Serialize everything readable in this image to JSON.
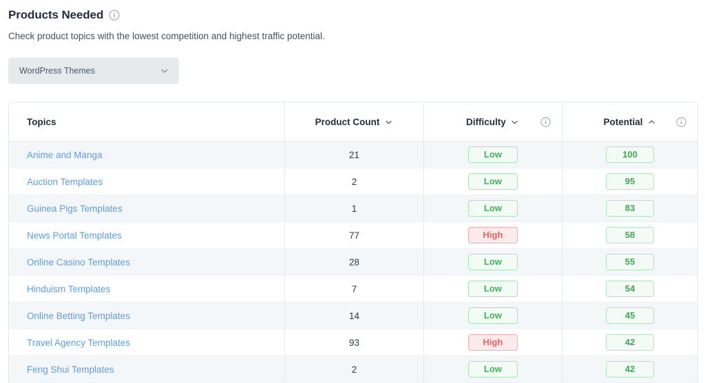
{
  "header": {
    "title": "Products Needed",
    "info_icon": "info-icon",
    "subtitle": "Check product topics with the lowest competition and highest traffic potential."
  },
  "filter": {
    "selected": "WordPress Themes",
    "chevron_icon": "chevron-down-icon"
  },
  "table": {
    "columns": [
      {
        "label": "Topics",
        "sort_icon": "",
        "info_icon": ""
      },
      {
        "label": "Product Count",
        "sort_icon": "chevron-down-icon",
        "info_icon": ""
      },
      {
        "label": "Difficulty",
        "sort_icon": "chevron-down-icon",
        "info_icon": "info-icon"
      },
      {
        "label": "Potential",
        "sort_icon": "chevron-up-icon",
        "info_icon": "info-icon"
      }
    ],
    "rows": [
      {
        "topic": "Anime and Manga",
        "product_count": "21",
        "difficulty": "Low",
        "potential": "100"
      },
      {
        "topic": "Auction Templates",
        "product_count": "2",
        "difficulty": "Low",
        "potential": "95"
      },
      {
        "topic": "Guinea Pigs Templates",
        "product_count": "1",
        "difficulty": "Low",
        "potential": "83"
      },
      {
        "topic": "News Portal Templates",
        "product_count": "77",
        "difficulty": "High",
        "potential": "58"
      },
      {
        "topic": "Online Casino Templates",
        "product_count": "28",
        "difficulty": "Low",
        "potential": "55"
      },
      {
        "topic": "Hinduism Templates",
        "product_count": "7",
        "difficulty": "Low",
        "potential": "54"
      },
      {
        "topic": "Online Betting Templates",
        "product_count": "14",
        "difficulty": "Low",
        "potential": "45"
      },
      {
        "topic": "Travel Agency Templates",
        "product_count": "93",
        "difficulty": "High",
        "potential": "42"
      },
      {
        "topic": "Feng Shui Templates",
        "product_count": "2",
        "difficulty": "Low",
        "potential": "42"
      }
    ]
  },
  "colors": {
    "link": "#5c9ee0",
    "low_text": "#44b05c",
    "low_bg": "#f2fbf4",
    "low_border": "#a9e3b5",
    "high_text": "#ef5f5f",
    "high_bg": "#fdeaea",
    "high_border": "#f5a9a9",
    "potential_text": "#3fa856",
    "row_stripe": "#f4f7fa",
    "divider": "#e3e8ee",
    "dropdown_bg": "#e7eaed"
  }
}
